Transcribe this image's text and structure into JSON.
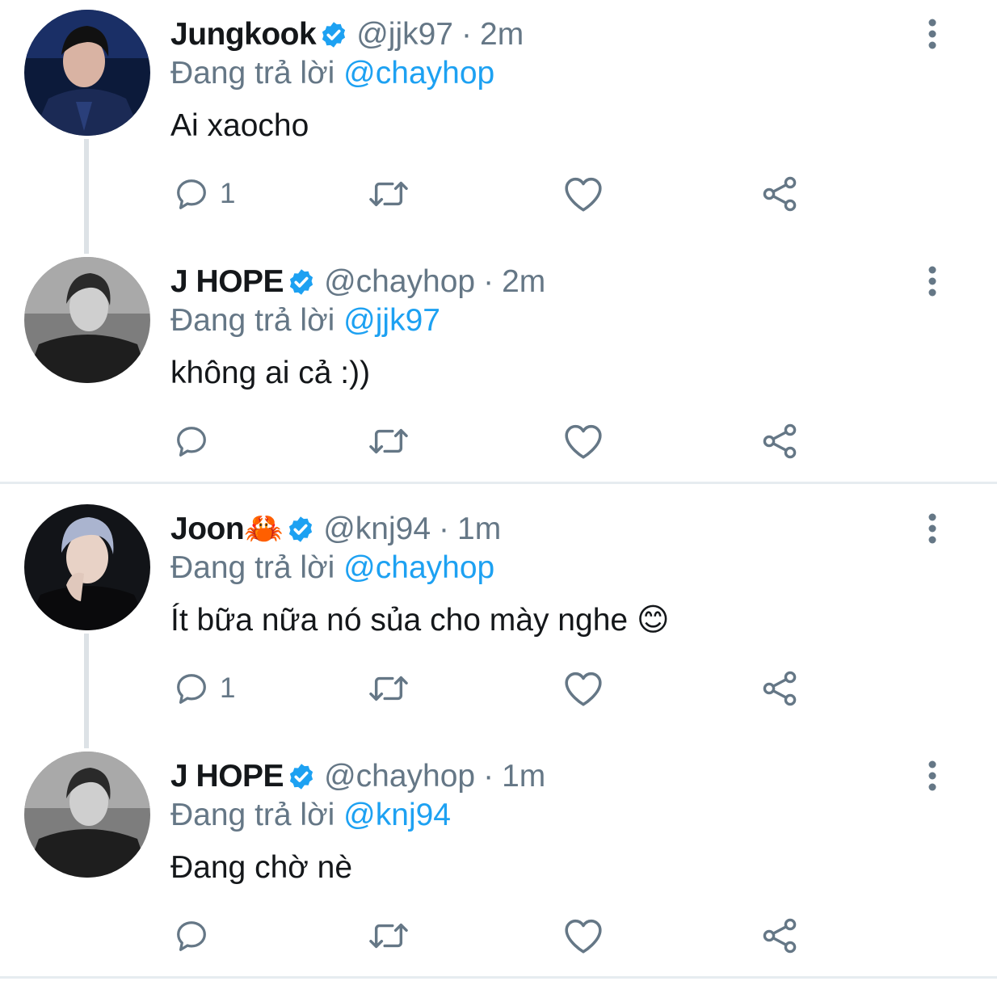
{
  "reply_prefix": "Đang trả lời",
  "tweets": [
    {
      "name": "Jungkook",
      "handle": "@jjk97",
      "separator": "·",
      "time": "2m",
      "reply_to": "@chayhop",
      "text": "Ai xaocho",
      "reply_count": "1",
      "avatar_icon": "user-photo-dark-blue"
    },
    {
      "name": "J HOPE",
      "handle": "@chayhop",
      "separator": "·",
      "time": "2m",
      "reply_to": "@jjk97",
      "text": "không ai cả :))",
      "reply_count": "",
      "avatar_icon": "user-photo-monochrome"
    },
    {
      "name": "Joon🦀",
      "handle": "@knj94",
      "separator": "·",
      "time": "1m",
      "reply_to": "@chayhop",
      "text": "Ít bữa nữa nó sủa cho mày nghe 😊",
      "reply_count": "1",
      "avatar_icon": "user-photo-silver-hair"
    },
    {
      "name": "J HOPE",
      "handle": "@chayhop",
      "separator": "·",
      "time": "1m",
      "reply_to": "@knj94",
      "text": "Đang chờ nè",
      "reply_count": "",
      "avatar_icon": "user-photo-monochrome"
    }
  ],
  "colors": {
    "accent": "#1da1f2",
    "secondary_text": "#657786",
    "icon": "#657786",
    "divider": "#e6ecf0"
  }
}
